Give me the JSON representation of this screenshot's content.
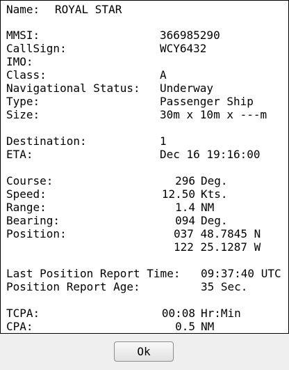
{
  "name_row": {
    "label": "Name:",
    "value": "ROYAL STAR"
  },
  "mmsi": {
    "label": "MMSI:",
    "value": "366985290"
  },
  "callsign": {
    "label": "CallSign:",
    "value": "WCY6432"
  },
  "imo": {
    "label": "IMO:",
    "value": ""
  },
  "class": {
    "label": "Class:",
    "value": "A"
  },
  "nav_status": {
    "label": "Navigational Status:",
    "value": "Underway"
  },
  "type": {
    "label": "Type:",
    "value": "Passenger Ship"
  },
  "size": {
    "label": "Size:",
    "value": "30m x 10m x ---m"
  },
  "destination": {
    "label": "Destination:",
    "value": "1"
  },
  "eta": {
    "label": "ETA:",
    "value": "Dec 16 19:16:00"
  },
  "course": {
    "label": "Course:",
    "value": "296",
    "unit": "Deg."
  },
  "speed": {
    "label": "Speed:",
    "value": "12.50",
    "unit": "Kts."
  },
  "range": {
    "label": "Range:",
    "value": "1.4",
    "unit": "NM"
  },
  "bearing": {
    "label": "Bearing:",
    "value": "094",
    "unit": "Deg."
  },
  "position": {
    "label": "Position:",
    "lat": "037 48.7845 N",
    "lon": "122 25.1287 W"
  },
  "last_report": {
    "label": "Last Position Report Time:",
    "value": "09:37:40 UTC"
  },
  "report_age": {
    "label": "Position Report Age:",
    "value": "35 Sec."
  },
  "tcpa": {
    "label": "TCPA:",
    "value": "00:08",
    "unit": "Hr:Min"
  },
  "cpa": {
    "label": "CPA:",
    "value": "0.5",
    "unit": "NM"
  },
  "ok_button": {
    "label": "Ok"
  }
}
